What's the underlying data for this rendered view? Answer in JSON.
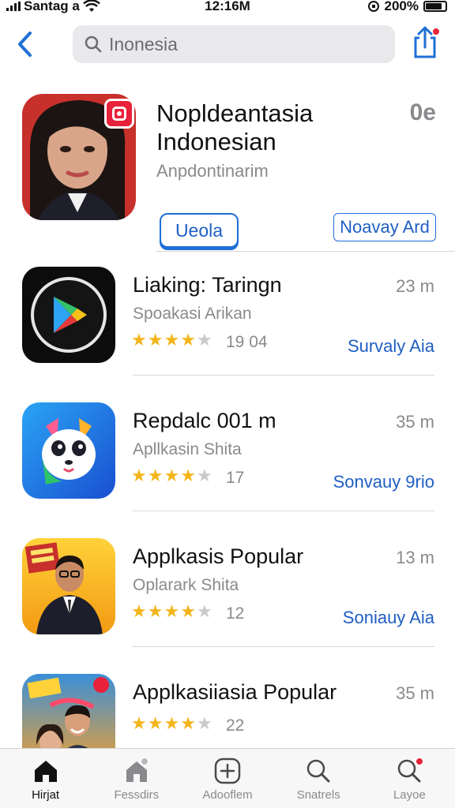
{
  "status_bar": {
    "carrier": "Santag a",
    "time": "12:16M",
    "battery_text": "200%"
  },
  "search": {
    "query": "Inonesia"
  },
  "featured": {
    "title_line1": "Nopldeantasia",
    "title_line2": "Indonesian",
    "subtitle": "Anpdontinarim",
    "side_value": "0e",
    "get_label": "Ueola",
    "secondary_label": "Noavay Ard",
    "accent": "#1f6fd6"
  },
  "apps": [
    {
      "name": "Liaking: Taringn",
      "subtitle": "Spoakasi Arikan",
      "rating": 4.5,
      "count": "19 04",
      "size": "23 m",
      "action": "Survaly Aia",
      "icon": "play-icon"
    },
    {
      "name": "Repdalc 001 m",
      "subtitle": "Apllkasin Shita",
      "rating": 4.5,
      "count": "17",
      "size": "35 m",
      "action": "Sonvauy 9rio",
      "icon": "panda-icon"
    },
    {
      "name": "Applkasis Popular",
      "subtitle": "Oplarark Shita",
      "rating": 4.5,
      "count": "12",
      "size": "13 m",
      "action": "Soniauy Aia",
      "icon": "businessman-icon"
    },
    {
      "name": "Applkasiiasia Popular",
      "subtitle": "",
      "rating": 4,
      "count": "22",
      "size": "35 m",
      "action": "",
      "icon": "movie-poster-icon"
    }
  ],
  "tabs": [
    {
      "label": "Hirjat",
      "icon": "home-icon",
      "active": true
    },
    {
      "label": "Fessdirs",
      "icon": "home-outline-icon",
      "active": false
    },
    {
      "label": "Adooflem",
      "icon": "plus-icon",
      "active": false
    },
    {
      "label": "Snatrels",
      "icon": "search-icon",
      "active": false
    },
    {
      "label": "Layoe",
      "icon": "search-badge-icon",
      "active": false
    }
  ],
  "colors": {
    "accent_blue": "#1f6fd6",
    "star": "#f3b51c",
    "badge_red": "#e8223a"
  }
}
